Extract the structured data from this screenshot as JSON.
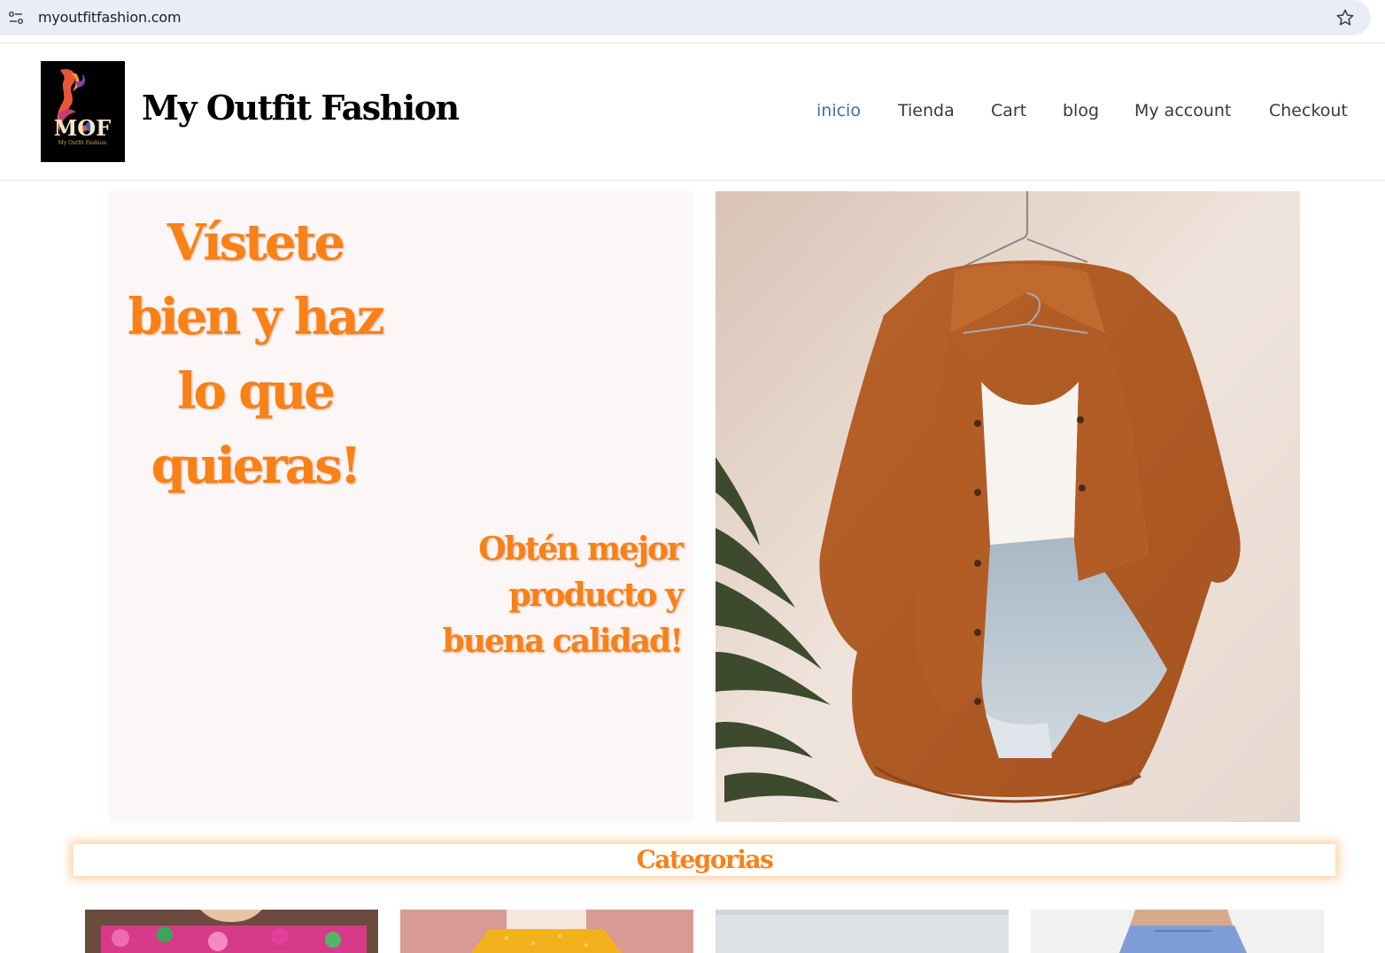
{
  "browser": {
    "url": "myoutfitfashion.com",
    "site_settings_icon": "tune-icon",
    "bookmark_icon": "star-icon"
  },
  "header": {
    "logo_text": "MOF",
    "logo_subtext": "My Outfit Fashion",
    "site_title": "My Outfit Fashion",
    "nav": [
      {
        "label": "inicio",
        "active": true
      },
      {
        "label": "Tienda"
      },
      {
        "label": "Cart"
      },
      {
        "label": "blog"
      },
      {
        "label": "My account"
      },
      {
        "label": "Checkout"
      }
    ]
  },
  "hero": {
    "title_lines": [
      "Vístete",
      "bien y haz",
      "lo que",
      "quieras!"
    ],
    "subtitle_lines": [
      "Obtén mejor",
      "producto y",
      "buena calidad!"
    ]
  },
  "categories": {
    "title": "Categorias"
  },
  "colors": {
    "accent_orange": "#f98116",
    "nav_active": "#3d6fa6",
    "hero_bg": "#fdf6f7"
  }
}
